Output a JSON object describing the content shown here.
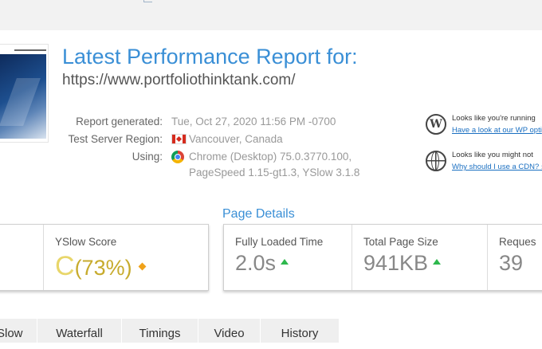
{
  "report": {
    "title": "Latest Performance Report for:",
    "url": "https://www.portfoliothinktank.com/",
    "generated_label": "Report generated:",
    "generated_value": "Tue, Oct 27, 2020 11:56 PM -0700",
    "region_label": "Test Server Region:",
    "region_value": "Vancouver, Canada",
    "using_label": "Using:",
    "using_line1": "Chrome (Desktop) 75.0.3770.100,",
    "using_line2": "PageSpeed 1.15-gt1.3, YSlow 3.1.8"
  },
  "side": {
    "wp_text": "Looks like you're running",
    "wp_link": "Have a look at our WP opti",
    "cdn_text": "Looks like you might not",
    "cdn_link": "Why should I use a CDN? ›"
  },
  "page_details": {
    "heading": "Page Details"
  },
  "scores": {
    "yslow": {
      "label": "YSlow Score",
      "grade": "C",
      "percent": "(73%)"
    }
  },
  "details": [
    {
      "label": "Fully Loaded Time",
      "value": "2.0s"
    },
    {
      "label": "Total Page Size",
      "value": "941KB"
    },
    {
      "label": "Reques",
      "value": "39"
    }
  ],
  "tabs": [
    "Slow",
    "Waterfall",
    "Timings",
    "Video",
    "History"
  ],
  "colors": {
    "accent": "#3a8fd6",
    "grade_c": "#c7ab2d",
    "up_arrow": "#2db84d",
    "diamond": "#f0a21a"
  },
  "icons": {
    "region_flag": "canada-flag-icon",
    "browser": "chrome-icon",
    "wordpress": "wordpress-icon",
    "cdn": "globe-icon"
  }
}
